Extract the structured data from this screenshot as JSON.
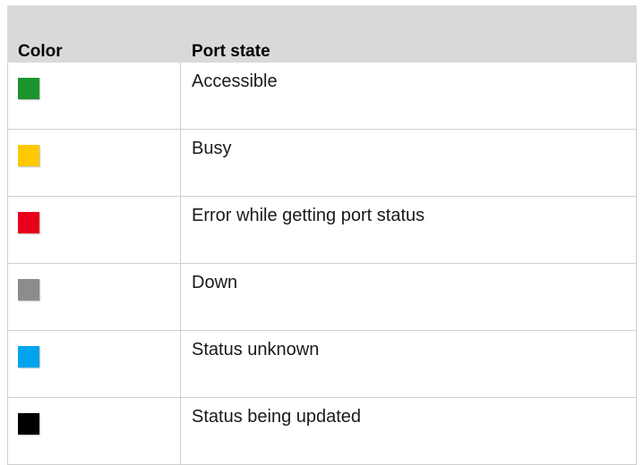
{
  "table": {
    "headers": {
      "color": "Color",
      "state": "Port state"
    },
    "rows": [
      {
        "color_hex": "#1b9430",
        "state": "Accessible"
      },
      {
        "color_hex": "#ffc800",
        "state": "Busy"
      },
      {
        "color_hex": "#e8001b",
        "state": "Error while getting port status"
      },
      {
        "color_hex": "#8c8c8c",
        "state": "Down"
      },
      {
        "color_hex": "#00a3ee",
        "state": "Status unknown"
      },
      {
        "color_hex": "#000000",
        "state": "Status being updated"
      }
    ]
  }
}
